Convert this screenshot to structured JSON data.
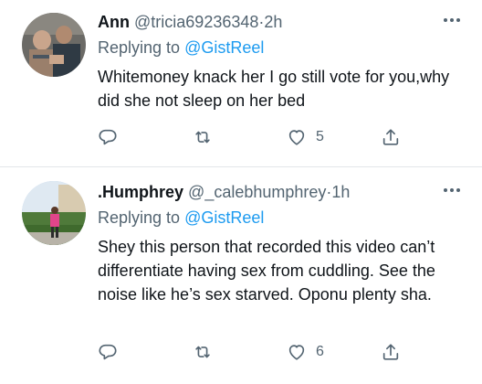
{
  "tweets": [
    {
      "name": "Ann",
      "handle": "@tricia69236348",
      "separator": "·",
      "time": "2h",
      "replying_prefix": "Replying to",
      "replying_to": "@GistReel",
      "text": "Whitemoney knack her I go still vote for you,why did she not sleep on her bed",
      "likes": "5"
    },
    {
      "name": ".Humphrey",
      "handle": "@_calebhumphrey",
      "separator": "·",
      "time": "1h",
      "replying_prefix": "Replying to",
      "replying_to": "@GistReel",
      "text": "Shey this person that recorded this video can’t differentiate having sex from cuddling. See the noise like he’s sex starved. Oponu plenty sha.",
      "likes": "6"
    }
  ],
  "icons": {
    "reply": "reply-icon",
    "retweet": "retweet-icon",
    "like": "heart-icon",
    "share": "share-icon",
    "more": "more-icon"
  },
  "colors": {
    "mention": "#1d9bf0",
    "secondary_text": "#536471",
    "primary_text": "#0f1419"
  }
}
